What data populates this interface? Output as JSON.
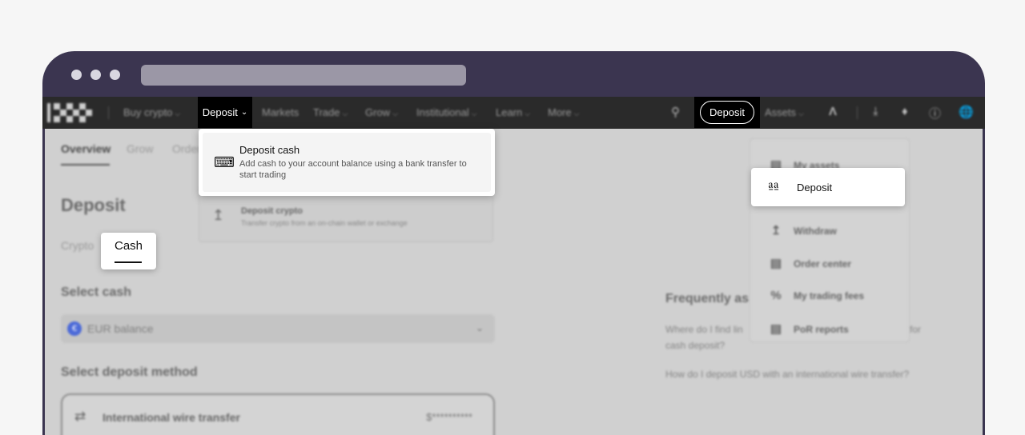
{
  "nav": {
    "items": [
      {
        "label": "Buy crypto",
        "chev": "⌵"
      },
      {
        "label": "Markets"
      },
      {
        "label": "Trade",
        "chev": "⌵"
      },
      {
        "label": "Grow",
        "chev": "⌵"
      },
      {
        "label": "Institutional",
        "chev": "⌵"
      },
      {
        "label": "Learn",
        "chev": "⌵"
      },
      {
        "label": "More",
        "chev": "⌵"
      }
    ],
    "deposit_menu": "Deposit",
    "deposit_button": "Deposit",
    "assets": "Assets"
  },
  "deposit_dropdown": {
    "cash_title": "Deposit cash",
    "cash_desc": "Add cash to your account balance using a bank transfer to start trading",
    "crypto_title": "Deposit crypto",
    "crypto_desc": "Transfer crypto from an on-chain wallet or exchange"
  },
  "page": {
    "tabs": [
      "Overview",
      "Grow",
      "Order"
    ],
    "title": "Deposit",
    "subtabs": {
      "crypto": "Crypto",
      "cash": "Cash"
    },
    "select_cash": "Select cash",
    "cash_option": "EUR balance",
    "select_method": "Select deposit method",
    "method": "International wire transfer",
    "method_value": "$**********"
  },
  "assets_menu": {
    "items": [
      "My assets",
      "Deposit",
      "Withdraw",
      "Order center",
      "My trading fees",
      "PoR reports"
    ]
  },
  "faq": {
    "title": "Frequently as",
    "q1_a": "Where do I find lin",
    "q1_b": "cash deposit?",
    "q1_c": "for",
    "q2": "How do I deposit USD with an international wire transfer?"
  }
}
